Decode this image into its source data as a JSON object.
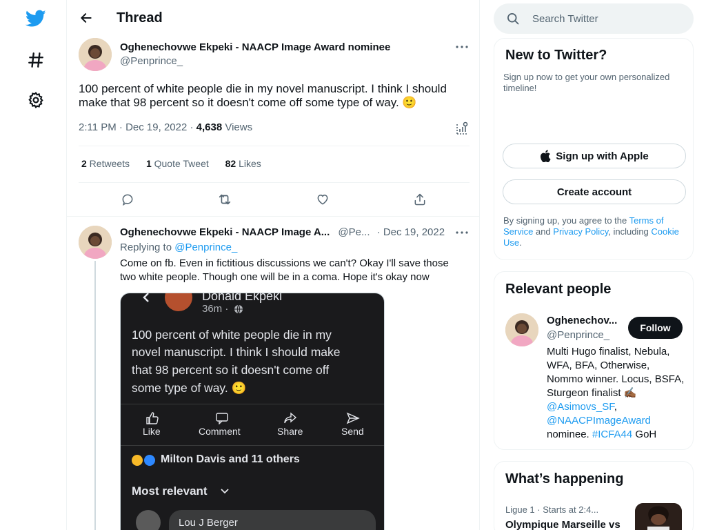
{
  "header": {
    "back_label": "Back",
    "title": "Thread"
  },
  "tweet": {
    "author_name": "Oghenechovwe Ekpeki - NAACP Image Award nominee",
    "author_handle": "@Penprince_",
    "text": "100 percent of white people die in my novel manuscript. I think I should make that 98 percent so it doesn't come off some type of way. 🙂",
    "time": "2:11 PM · Dec 19, 2022 · ",
    "views_count": "4,638",
    "views_label": " Views",
    "stats": {
      "retweets_count": "2",
      "retweets_label": " Retweets",
      "quotes_count": "1",
      "quotes_label": " Quote Tweet",
      "likes_count": "82",
      "likes_label": " Likes"
    }
  },
  "reply": {
    "author_name": "Oghenechovwe Ekpeki - NAACP Image A...",
    "author_handle": "@Pe...",
    "date": "· Dec 19, 2022",
    "replying_prefix": "Replying to ",
    "replying_handle": "@Penprince_",
    "text": "Come on fb. Even in fictitious discussions we can't? Okay I'll save those two white people. Though one will be in a coma. Hope it's okay now",
    "media": {
      "poster_name": "Donald Ekpeki",
      "post_time": "36m ·",
      "post_lines": [
        "100 percent of white people die in my",
        "novel manuscript. I think I should make",
        "that 98 percent so it doesn't come off",
        "some type of way. 🙂"
      ],
      "actions": [
        "Like",
        "Comment",
        "Share",
        "Send"
      ],
      "reactions_text": "Milton Davis and 11 others",
      "sort_label": "Most relevant",
      "commenter": "Lou J Berger"
    }
  },
  "search": {
    "placeholder": "Search Twitter"
  },
  "signup_card": {
    "title": "New to Twitter?",
    "subtitle": "Sign up now to get your own personalized timeline!",
    "apple_button": "Sign up with Apple",
    "create_button": "Create account",
    "legal_1": "By signing up, you agree to the ",
    "terms_link": "Terms of Service",
    "legal_2": " and ",
    "privacy_link": "Privacy Policy",
    "legal_3": ", including ",
    "cookie_link": "Cookie Use",
    "legal_4": "."
  },
  "relevant_people": {
    "title": "Relevant people",
    "name": "Oghenechov...",
    "handle": "@Penprince_",
    "follow_label": "Follow",
    "bio_1": "Multi Hugo finalist, Nebula, WFA, BFA, Otherwise, Nommo winner. Locus, BSFA, Sturgeon finalist ✍🏾",
    "bio_link_1": "@Asimovs_SF",
    "bio_sep": ",",
    "bio_link_2": "@NAACPImageAward",
    "bio_2": " nominee. ",
    "bio_link_3": "#ICFA44",
    "bio_3": " GoH"
  },
  "whats_happening": {
    "title": "What’s happening",
    "trend_meta": "Ligue 1 · Starts at 2:4...",
    "trend_title": "Olympique Marseille vs"
  },
  "colors": {
    "accent": "#1d9bf0",
    "text": "#0f1419",
    "muted": "#536471",
    "border": "#eff3f4"
  }
}
